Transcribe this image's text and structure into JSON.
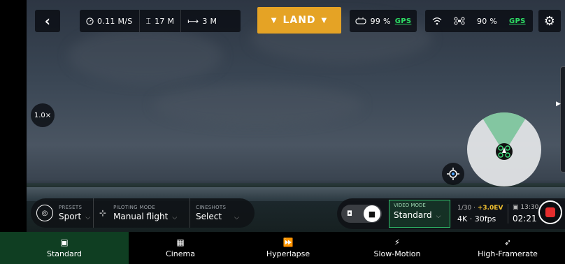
{
  "top_bar": {
    "back_icon": "chevron-left-icon",
    "speed": "0.11 M/S",
    "altitude": "17 M",
    "distance": "3 M",
    "land_label": "LAND",
    "controller_battery": "99 %",
    "controller_gps": "GPS",
    "drone_battery": "90 %",
    "drone_gps": "GPS",
    "settings_icon": "gear-icon"
  },
  "zoom_level": "1.0×",
  "pilot_bar": {
    "presets_label": "PRESETS",
    "presets_value": "Sport",
    "piloting_label": "PILOTING MODE",
    "piloting_value": "Manual flight",
    "cineshots_label": "CINESHOTS",
    "cineshots_value": "Select"
  },
  "camera_bar": {
    "video_mode_label": "VIDEO MODE",
    "video_mode_value": "Standard",
    "shutter": "1/30",
    "ev": "+3.0EV",
    "resolution": "4K · 30fps",
    "storage_time": "13:30",
    "record_time": "02:21"
  },
  "mode_tabs": [
    {
      "label": "Standard",
      "icon": "play-square-icon",
      "active": true
    },
    {
      "label": "Cinema",
      "icon": "clapperboard-icon",
      "active": false
    },
    {
      "label": "Hyperlapse",
      "icon": "fast-forward-icon",
      "active": false
    },
    {
      "label": "Slow-Motion",
      "icon": "slow-runner-icon",
      "active": false
    },
    {
      "label": "High-Framerate",
      "icon": "runner-icon",
      "active": false
    }
  ],
  "colors": {
    "accent_land": "#e5a325",
    "gps_green": "#2ddc64",
    "video_mode_border": "#2fbf6a",
    "ev_yellow": "#f0c030",
    "record_red": "#e52d2d",
    "active_tab": "#0f3e22"
  }
}
